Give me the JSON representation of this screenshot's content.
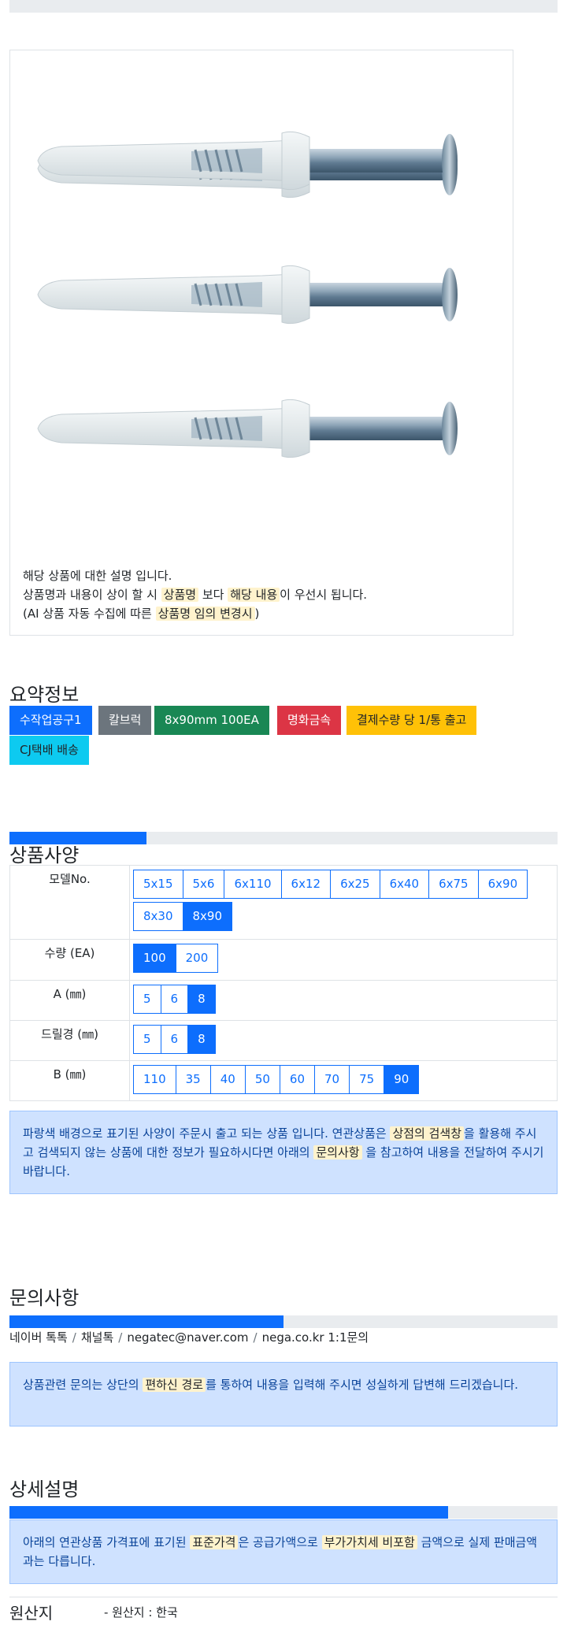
{
  "description": {
    "line1": "해당 상품에 대한 설명 입니다.",
    "line2_pre": "상품명과 내용이 상이 할 시 ",
    "line2_hl1": "상품명",
    "line2_mid": " 보다 ",
    "line2_hl2": "해당 내용",
    "line2_post": "이 우선시 됩니다.",
    "line3_pre": "(AI 상품 자동 수집에 따른 ",
    "line3_hl": "상품명 임의 변경시",
    "line3_post": ")"
  },
  "summary": {
    "title": "요약정보",
    "tags": [
      {
        "label": "수작업공구1",
        "color": "#0d6efd",
        "text": "#ffffff"
      },
      {
        "label": "칼브럭",
        "color": "#6c757d",
        "text": "#ffffff"
      },
      {
        "label": "8x90mm 100EA",
        "color": "#198754",
        "text": "#ffffff"
      },
      {
        "label": "명화금속",
        "color": "#dc3545",
        "text": "#ffffff"
      },
      {
        "label": "결제수량 당 1/통 출고",
        "color": "#ffc107",
        "text": "#212529"
      },
      {
        "label": "CJ택배 배송",
        "color": "#0dcaf0",
        "text": "#212529"
      }
    ]
  },
  "spec": {
    "progress": 0.25,
    "title": "상품사양",
    "rows": [
      {
        "label": "모델No.",
        "options": [
          "5x15",
          "5x6",
          "6x110",
          "6x12",
          "6x25",
          "6x40",
          "6x75",
          "6x90",
          "8x30",
          "8x90"
        ],
        "selected": "8x90"
      },
      {
        "label": "수량 (EA)",
        "options": [
          "100",
          "200"
        ],
        "selected": "100"
      },
      {
        "label": "A (㎜)",
        "options": [
          "5",
          "6",
          "8"
        ],
        "selected": "8"
      },
      {
        "label": "드릴경 (㎜)",
        "options": [
          "5",
          "6",
          "8"
        ],
        "selected": "8"
      },
      {
        "label": "B (㎜)",
        "options": [
          "110",
          "35",
          "40",
          "50",
          "60",
          "70",
          "75",
          "90"
        ],
        "selected": "90"
      }
    ],
    "notice_pre": "파랑색 배경으로 표기된 사양이 주문시 출고 되는 상품 입니다. 연관상품은 ",
    "notice_hl1": "상점의 검색창",
    "notice_mid": "을 활용해 주시고 검색되지 않는 상품에 대한 정보가 필요하시다면 아래의 ",
    "notice_hl2": "문의사항",
    "notice_post": " 을 참고하여 내용을 전달하여 주시기 바랍니다."
  },
  "inquiry": {
    "title": "문의사항",
    "progress": 0.5,
    "links": [
      "네이버 톡톡",
      "채널톡",
      "negatec@naver.com",
      "nega.co.kr 1:1문의"
    ],
    "notice_pre": "상품관련 문의는 상단의 ",
    "notice_hl": "편하신 경로",
    "notice_post": "를 통하여 내용을 입력해 주시면 성실하게 답변해 드리겠습니다."
  },
  "detail": {
    "title": "상세설명",
    "progress": 0.8,
    "notice_pre": "아래의 연관상품 가격표에 표기된 ",
    "notice_hl1": "표준가격",
    "notice_mid": "은 공급가액으로 ",
    "notice_hl2": "부가가치세 비포함",
    "notice_post": " 금액으로 실제 판매금액과는 다릅니다."
  },
  "origin": {
    "label": "원산지",
    "value": "- 원산지 : 한국"
  }
}
